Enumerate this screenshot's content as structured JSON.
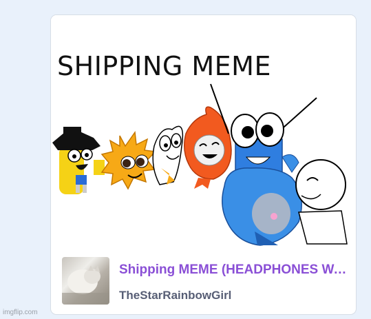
{
  "card": {
    "thumbnail_text": "SHIPPING MEME",
    "title": "Shipping MEME (HEADPHONES WARNING)",
    "author": "TheStarRainbowGirl"
  },
  "watermark": "imgflip.com",
  "colors": {
    "page_background": "#e9f1fb",
    "card_background": "#ffffff",
    "title_color": "#8a4fd6",
    "author_color": "#575e75"
  }
}
